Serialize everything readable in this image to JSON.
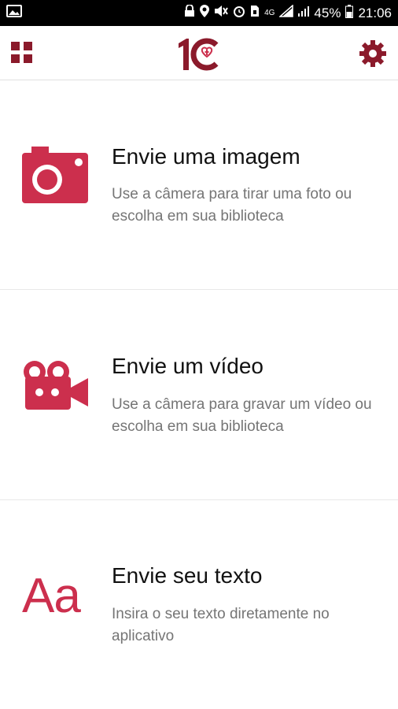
{
  "status_bar": {
    "battery_percent": "45%",
    "time": "21:06",
    "network": "4G"
  },
  "app_bar": {
    "logo_text": "1C",
    "menu_icon": "grid-icon",
    "settings_icon": "gear-icon"
  },
  "colors": {
    "accent": "#cc2f4d",
    "dark_red": "#8b1a2b",
    "title_text": "#111111",
    "desc_text": "#757575"
  },
  "options": [
    {
      "icon": "camera-icon",
      "title": "Envie uma imagem",
      "description": "Use a câmera para tirar uma foto ou escolha em sua biblioteca"
    },
    {
      "icon": "video-camera-icon",
      "title": "Envie um vídeo",
      "description": "Use a câmera para gravar um vídeo ou escolha em sua biblioteca"
    },
    {
      "icon": "text-icon",
      "icon_text": "Aa",
      "title": "Envie seu texto",
      "description": "Insira o seu texto diretamente no aplicativo"
    }
  ]
}
